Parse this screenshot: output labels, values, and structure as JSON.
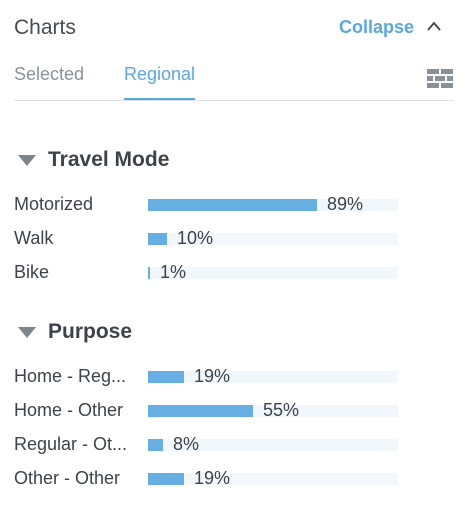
{
  "header": {
    "title": "Charts",
    "collapse_label": "Collapse"
  },
  "tabs": [
    {
      "label": "Selected",
      "active": false
    },
    {
      "label": "Regional",
      "active": true
    }
  ],
  "colors": {
    "accent": "#5aa8e0",
    "bar": "#67aee3",
    "track": "#f2f7fb"
  },
  "icons": {
    "collapse": "chevron-up-icon",
    "view": "grid-table-icon",
    "section_toggle": "triangle-down-icon"
  },
  "sections": [
    {
      "title": "Travel Mode",
      "rows": [
        {
          "label": "Motorized",
          "value": 89,
          "text": "89%"
        },
        {
          "label": "Walk",
          "value": 10,
          "text": "10%"
        },
        {
          "label": "Bike",
          "value": 1,
          "text": "1%"
        }
      ]
    },
    {
      "title": "Purpose",
      "rows": [
        {
          "label": "Home - Reg...",
          "value": 19,
          "text": "19%"
        },
        {
          "label": "Home - Other",
          "value": 55,
          "text": "55%"
        },
        {
          "label": "Regular - Ot...",
          "value": 8,
          "text": "8%"
        },
        {
          "label": "Other - Other",
          "value": 19,
          "text": "19%"
        }
      ]
    }
  ]
}
